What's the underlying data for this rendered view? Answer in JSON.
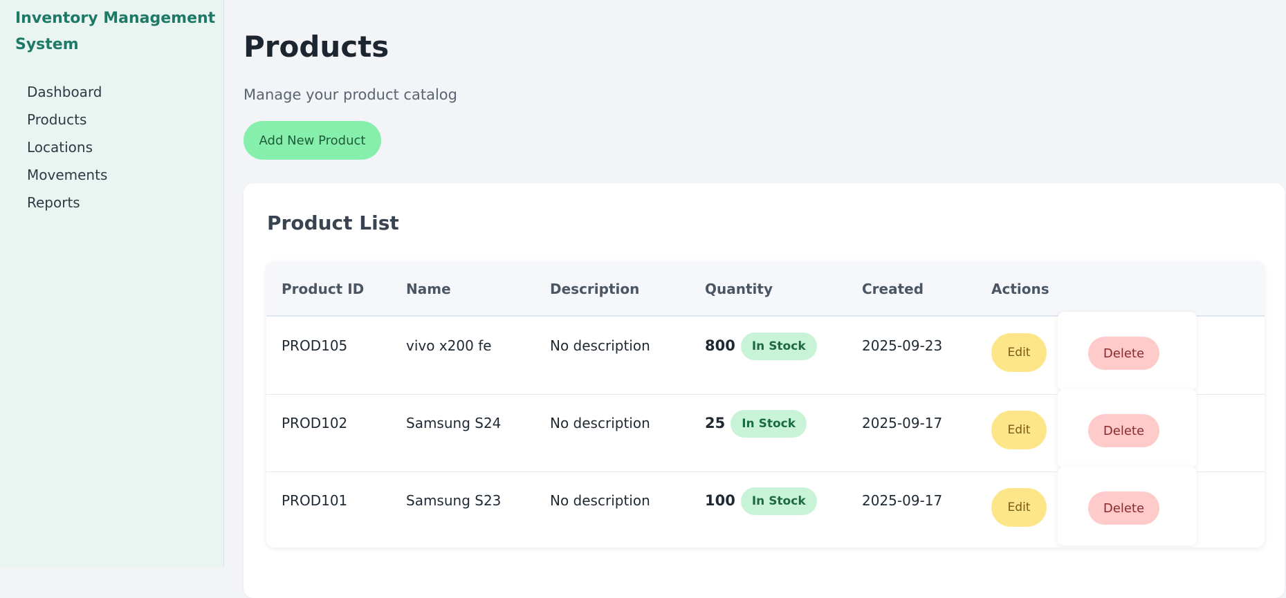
{
  "sidebar": {
    "brand": "Inventory Management System",
    "items": [
      {
        "label": "Dashboard"
      },
      {
        "label": "Products"
      },
      {
        "label": "Locations"
      },
      {
        "label": "Movements"
      },
      {
        "label": "Reports"
      }
    ]
  },
  "header": {
    "title": "Products",
    "subtitle": "Manage your product catalog",
    "add_button": "Add New Product"
  },
  "product_list": {
    "title": "Product List",
    "columns": [
      "Product ID",
      "Name",
      "Description",
      "Quantity",
      "Created",
      "Actions"
    ],
    "rows": [
      {
        "id": "PROD105",
        "name": "vivo x200 fe",
        "description": "No description",
        "quantity": "800",
        "status": "In Stock",
        "created": "2025-09-23",
        "edit": "Edit",
        "delete": "Delete"
      },
      {
        "id": "PROD102",
        "name": "Samsung S24",
        "description": "No description",
        "quantity": "25",
        "status": "In Stock",
        "created": "2025-09-17",
        "edit": "Edit",
        "delete": "Delete"
      },
      {
        "id": "PROD101",
        "name": "Samsung S23",
        "description": "No description",
        "quantity": "100",
        "status": "In Stock",
        "created": "2025-09-17",
        "edit": "Edit",
        "delete": "Delete"
      }
    ]
  },
  "colors": {
    "sidebar_bg": "#eaf5f1",
    "brand": "#1e7a67",
    "add_button": "#86efac",
    "in_stock_badge": "#c8f3d6",
    "edit_button": "#fde68a",
    "delete_button": "#fecaca"
  }
}
